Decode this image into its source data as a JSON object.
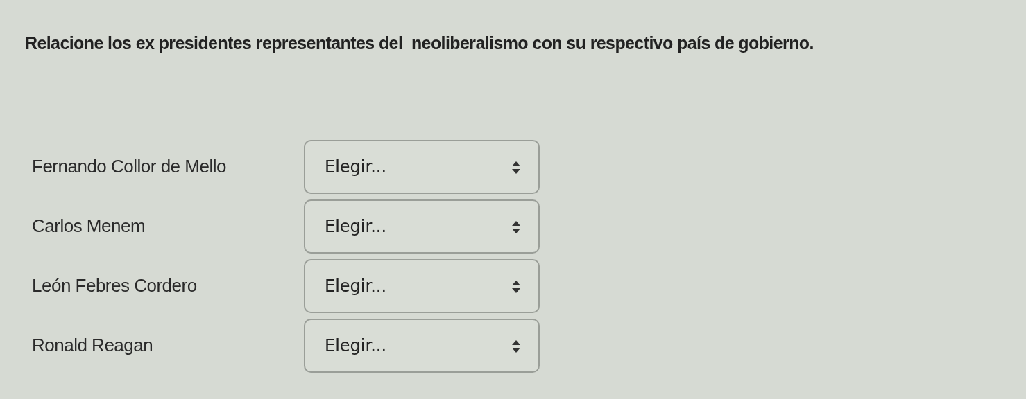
{
  "question": {
    "text": "Relacione los ex presidentes representantes del  neoliberalismo con su respectivo país de gobierno."
  },
  "matches": [
    {
      "name": "Fernando Collor de Mello",
      "select": {
        "value": "Elegir..."
      }
    },
    {
      "name": "Carlos Menem",
      "select": {
        "value": "Elegir..."
      }
    },
    {
      "name": "León Febres Cordero",
      "select": {
        "value": "Elegir..."
      }
    },
    {
      "name": "Ronald Reagan",
      "select": {
        "value": "Elegir..."
      }
    }
  ]
}
